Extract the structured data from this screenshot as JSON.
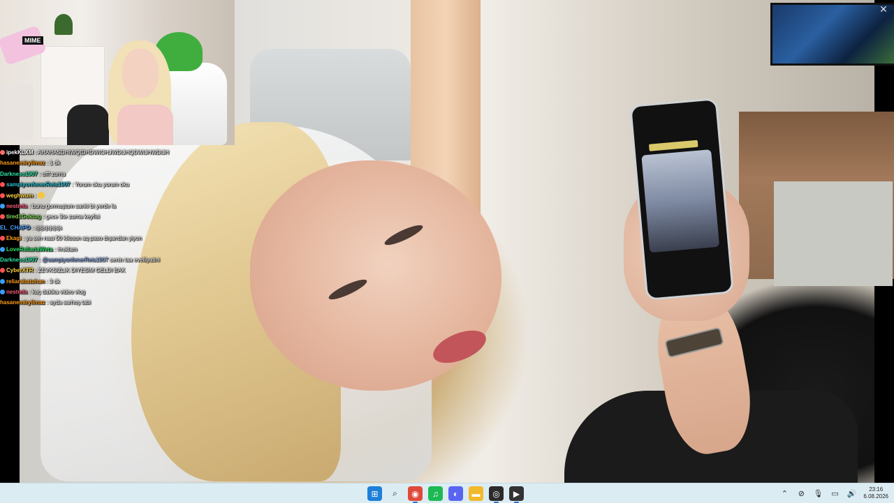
{
  "chat": {
    "messages": [
      {
        "user": "ipekKLXM",
        "user_color": "#ffffff",
        "badge_color": "#ff6b6b",
        "text": "AHAHASDHIWQIDHDWIOHJWDIJHQDWIJHWDIJH",
        "mention": ""
      },
      {
        "user": "hasanemiryilmaz",
        "user_color": "#ff9f1a",
        "badge_color": "",
        "text": "1 dk",
        "mention": ""
      },
      {
        "user": "Darkness1907",
        "user_color": "#2ee6a6",
        "badge_color": "",
        "text": "ufff zurna",
        "mention": ""
      },
      {
        "user": "sampiyonfenerReis1907",
        "user_color": "#29c3d6",
        "badge_color": "#ff5252",
        "text": "Yorum oku yorum oku",
        "mention": ""
      },
      {
        "user": "weghwum",
        "user_color": "#ffd43b",
        "badge_color": "#ff5252",
        "text": "",
        "mention": "",
        "emoji": true
      },
      {
        "user": "nestmia",
        "user_color": "#ff5a7a",
        "badge_color": "#3aa0ff",
        "text": "bunu gormuştum sanki bi yerde la",
        "mention": ""
      },
      {
        "user": "tired1Goktug",
        "user_color": "#7ed957",
        "badge_color": "#ff5252",
        "text": "gece 3te zurna keyfisi",
        "mention": ""
      },
      {
        "user": "EL_CHAPO",
        "user_color": "#4aa3ff",
        "badge_color": "",
        "text": "sjsjsjsjsjsjs",
        "mention": ""
      },
      {
        "user": "Ekagi",
        "user_color": "#ff9f1a",
        "badge_color": "#ff5252",
        "text": "ya sen nasi 50 kilosun aq paso dışarıdan yiyon",
        "mention": ""
      },
      {
        "user": "LoveReliariaWeta",
        "user_color": "#2ee66a",
        "badge_color": "#3aa0ff",
        "text": "#reklam",
        "mention": ""
      },
      {
        "user": "Darkness1907",
        "user_color": "#2ee6a6",
        "badge_color": "",
        "text": "senin taa evelliyatini",
        "mention": "@sampiyonfenerReis1907"
      },
      {
        "user": "CyberXTR",
        "user_color": "#ffd43b",
        "badge_color": "#ff5252",
        "text": "ZEVKSIZLIK DIYESIM GELDI BAK",
        "mention": ""
      },
      {
        "user": "reliarabatuhan",
        "user_color": "#ff9f1a",
        "badge_color": "#3aa0ff",
        "text": "3 dk",
        "mention": ""
      },
      {
        "user": "nestmia",
        "user_color": "#ff5a7a",
        "badge_color": "#3aa0ff",
        "text": "kaç dakika video vlog",
        "mention": ""
      },
      {
        "user": "hasanemiryilmaz",
        "user_color": "#ff9f1a",
        "badge_color": "",
        "text": "ayda sarhoş tabi",
        "mention": ""
      }
    ]
  },
  "webcam": {
    "logo": "MIME"
  },
  "player": {
    "close_glyph": "✕"
  },
  "taskbar": {
    "apps": [
      {
        "name": "start-icon",
        "glyph": "⊞",
        "bg": "#1e7fd8",
        "active": false
      },
      {
        "name": "search-icon",
        "glyph": "⌕",
        "bg": "transparent",
        "active": false
      },
      {
        "name": "chrome-icon",
        "glyph": "◉",
        "bg": "#e04a3a",
        "active": true
      },
      {
        "name": "spotify-icon",
        "glyph": "♫",
        "bg": "#1db954",
        "active": false
      },
      {
        "name": "discord-icon",
        "glyph": "◐",
        "bg": "#5865f2",
        "active": false
      },
      {
        "name": "file-explorer-icon",
        "glyph": "▬",
        "bg": "#f2b92b",
        "active": false
      },
      {
        "name": "obs-icon",
        "glyph": "◎",
        "bg": "#2b2b2b",
        "active": true
      },
      {
        "name": "media-player-icon",
        "glyph": "▶",
        "bg": "#333333",
        "active": true
      }
    ],
    "tray": [
      {
        "name": "chevron-up-icon",
        "glyph": "⌃"
      },
      {
        "name": "network-off-icon",
        "glyph": "⊘"
      },
      {
        "name": "microphone-icon",
        "glyph": "🎙"
      },
      {
        "name": "display-icon",
        "glyph": "▭"
      },
      {
        "name": "speaker-icon",
        "glyph": "🔊"
      }
    ],
    "time": "23:16",
    "date": "6.08.2026"
  }
}
